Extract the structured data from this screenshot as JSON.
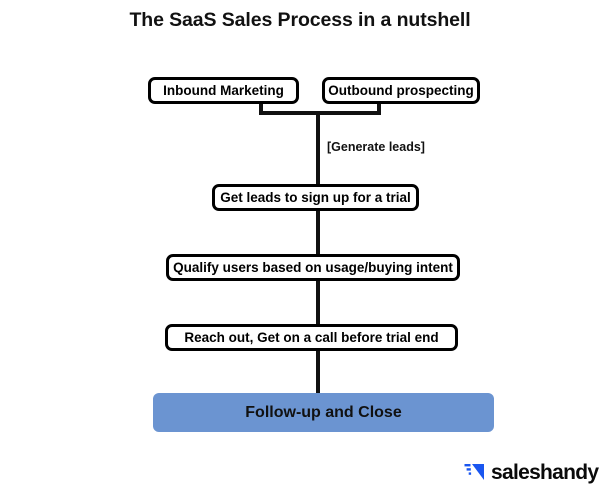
{
  "page": {
    "title": "The SaaS Sales Process in a nutshell",
    "background_color": "#ffffff"
  },
  "diagram": {
    "type": "flowchart",
    "orientation": "top-to-bottom",
    "node_border_color": "#000000",
    "accent_color": "#6b94d1",
    "connector_color": "#111111",
    "nodes": [
      {
        "id": "inbound",
        "label": "Inbound Marketing",
        "style": "outlined"
      },
      {
        "id": "outbound",
        "label": "Outbound prospecting",
        "style": "outlined"
      },
      {
        "id": "trial",
        "label": "Get leads to sign up for a trial",
        "style": "outlined"
      },
      {
        "id": "qualify",
        "label": "Qualify users based on usage/buying intent",
        "style": "outlined"
      },
      {
        "id": "reachout",
        "label": "Reach out, Get on a call before trial end",
        "style": "outlined"
      },
      {
        "id": "followup",
        "label": "Follow-up and Close",
        "style": "filled"
      }
    ],
    "edges": [
      {
        "from": "inbound,outbound",
        "to": "trial",
        "label": "[Generate leads]"
      },
      {
        "from": "trial",
        "to": "qualify",
        "label": ""
      },
      {
        "from": "qualify",
        "to": "reachout",
        "label": ""
      },
      {
        "from": "reachout",
        "to": "followup",
        "label": ""
      }
    ]
  },
  "branding": {
    "name": "saleshandy",
    "mark_icon": "arrow-triangle-icon",
    "mark_color": "#1a56f0",
    "text_color": "#0a0a0a"
  }
}
